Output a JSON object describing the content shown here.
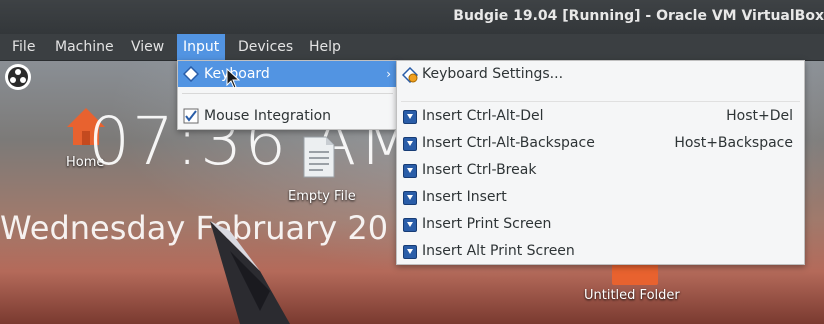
{
  "window": {
    "title": "Budgie 19.04 [Running] - Oracle VM VirtualBox"
  },
  "menubar": {
    "items": [
      {
        "label": "File"
      },
      {
        "label": "Machine"
      },
      {
        "label": "View"
      },
      {
        "label": "Input",
        "active": true
      },
      {
        "label": "Devices"
      },
      {
        "label": "Help"
      }
    ]
  },
  "desktop": {
    "clock": "07:36 AM",
    "date": "Wednesday February 20",
    "icons": [
      {
        "label": "Home",
        "icon": "home-icon"
      },
      {
        "label": "Empty File",
        "icon": "file-icon"
      },
      {
        "label": "Untitled Folder",
        "icon": "folder-icon"
      }
    ]
  },
  "input_menu": {
    "items": [
      {
        "label": "Keyboard",
        "icon": "keyboard-icon",
        "highlighted": true,
        "has_submenu": true
      },
      {
        "label": "Mouse Integration",
        "icon": "mouse-integration-icon",
        "checked": true
      }
    ]
  },
  "keyboard_submenu": {
    "settings": {
      "label": "Keyboard Settings...",
      "icon": "keyboard-settings-icon"
    },
    "items": [
      {
        "label": "Insert Ctrl-Alt-Del",
        "shortcut": "Host+Del"
      },
      {
        "label": "Insert Ctrl-Alt-Backspace",
        "shortcut": "Host+Backspace"
      },
      {
        "label": "Insert Ctrl-Break",
        "shortcut": ""
      },
      {
        "label": "Insert Insert",
        "shortcut": ""
      },
      {
        "label": "Insert Print Screen",
        "shortcut": ""
      },
      {
        "label": "Insert Alt Print Screen",
        "shortcut": ""
      }
    ]
  },
  "colors": {
    "accent": "#5294e2",
    "menubar": "#3b3f42",
    "menu_bg": "#f5f6f7"
  }
}
